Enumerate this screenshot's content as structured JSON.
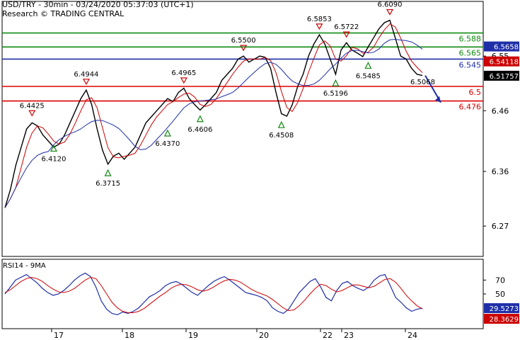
{
  "header": {
    "line1": "USD/TRY - 30min - 03/24/2020 05:37:03 (UTC+1)",
    "line2": "Research © TRADING CENTRAL"
  },
  "chart_data": {
    "type": "line",
    "instrument": "USD/TRY",
    "timeframe": "30min",
    "price_axis": {
      "ylim": [
        6.22,
        6.64
      ],
      "ticks": [
        "6.55",
        "6.46",
        "6.36",
        "6.27"
      ]
    },
    "x_ticks": [
      "17",
      "18",
      "19",
      "20",
      "22",
      "23",
      "24"
    ],
    "current_price": "6.51757",
    "price_tags": [
      {
        "value": 6.5658,
        "label": "6.5658",
        "color": "#1f2fa8"
      },
      {
        "value": 6.54118,
        "label": "6.54118",
        "color": "#cc0000"
      }
    ],
    "levels": [
      {
        "value": 6.588,
        "label": "6.588",
        "color": "#118a11"
      },
      {
        "value": 6.565,
        "label": "6.565",
        "color": "#118a11"
      },
      {
        "value": 6.545,
        "label": "6.545",
        "color": "#1f2fa8"
      },
      {
        "value": 6.5,
        "label": "6.5",
        "color": "#dd0000"
      },
      {
        "value": 6.476,
        "label": "6.476",
        "color": "#dd0000"
      }
    ],
    "swing_highs": [
      {
        "label": "6.4425",
        "value": 6.4425
      },
      {
        "label": "6.4944",
        "value": 6.4944
      },
      {
        "label": "6.4965",
        "value": 6.4965
      },
      {
        "label": "6.5500",
        "value": 6.55
      },
      {
        "label": "6.5853",
        "value": 6.5853
      },
      {
        "label": "6.5722",
        "value": 6.5722
      },
      {
        "label": "6.6090",
        "value": 6.609
      }
    ],
    "swing_lows": [
      {
        "label": "6.4120",
        "value": 6.412
      },
      {
        "label": "6.3715",
        "value": 6.3715
      },
      {
        "label": "6.4370",
        "value": 6.437
      },
      {
        "label": "6.4606",
        "value": 6.4606
      },
      {
        "label": "6.4508",
        "value": 6.4508
      },
      {
        "label": "6.5196",
        "value": 6.5196
      },
      {
        "label": "6.5485",
        "value": 6.5485
      }
    ],
    "target_label": "6.5068",
    "price_path": [
      6.3,
      6.33,
      6.37,
      6.4,
      6.43,
      6.44,
      6.435,
      6.42,
      6.41,
      6.4,
      6.405,
      6.42,
      6.44,
      6.46,
      6.48,
      6.494,
      6.47,
      6.43,
      6.395,
      6.372,
      6.385,
      6.39,
      6.38,
      6.39,
      6.4,
      6.42,
      6.44,
      6.45,
      6.46,
      6.47,
      6.48,
      6.475,
      6.49,
      6.497,
      6.48,
      6.47,
      6.461,
      6.47,
      6.48,
      6.49,
      6.51,
      6.52,
      6.53,
      6.545,
      6.55,
      6.54,
      6.545,
      6.55,
      6.548,
      6.53,
      6.49,
      6.455,
      6.451,
      6.47,
      6.5,
      6.52,
      6.55,
      6.57,
      6.585,
      6.57,
      6.545,
      6.52,
      6.56,
      6.572,
      6.56,
      6.555,
      6.549,
      6.565,
      6.58,
      6.595,
      6.605,
      6.609,
      6.58,
      6.55,
      6.545,
      6.53,
      6.52,
      6.518
    ],
    "rsi": {
      "title": "RSI14 - 9MA",
      "ylim": [
        0,
        100
      ],
      "ticks": [
        "70",
        "50"
      ],
      "current": "29.5273",
      "ma_value": "28.3629",
      "series": [
        50,
        60,
        70,
        74,
        78,
        72,
        66,
        58,
        52,
        48,
        50,
        55,
        62,
        70,
        76,
        80,
        75,
        60,
        40,
        28,
        22,
        20,
        24,
        22,
        25,
        30,
        38,
        46,
        50,
        55,
        62,
        66,
        68,
        64,
        58,
        52,
        48,
        55,
        62,
        68,
        72,
        75,
        70,
        64,
        58,
        52,
        50,
        48,
        45,
        40,
        30,
        25,
        22,
        28,
        40,
        52,
        60,
        68,
        72,
        60,
        45,
        40,
        55,
        65,
        68,
        62,
        58,
        55,
        60,
        70,
        76,
        78,
        62,
        45,
        38,
        30,
        25,
        28,
        29.5
      ],
      "ma_series": [
        52,
        56,
        62,
        68,
        72,
        74,
        72,
        68,
        62,
        57,
        53,
        52,
        54,
        58,
        64,
        70,
        74,
        72,
        62,
        50,
        38,
        30,
        25,
        23,
        23,
        25,
        29,
        35,
        41,
        47,
        52,
        58,
        62,
        64,
        63,
        60,
        56,
        54,
        56,
        60,
        65,
        69,
        71,
        70,
        67,
        62,
        57,
        53,
        50,
        47,
        42,
        36,
        30,
        26,
        27,
        33,
        41,
        50,
        58,
        64,
        62,
        57,
        53,
        55,
        59,
        63,
        63,
        61,
        59,
        61,
        66,
        71,
        72,
        67,
        58,
        48,
        40,
        33,
        28.4
      ]
    }
  }
}
